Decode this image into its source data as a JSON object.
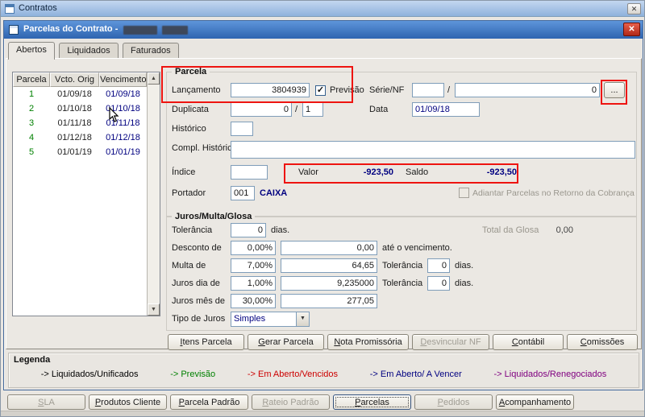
{
  "icons": {
    "close": "✕",
    "check": "✓",
    "dropdown_arrow": "▼",
    "scroll_up": "▲",
    "scroll_down": "▼"
  },
  "colors": {
    "previsao_green": "#008000",
    "vencidos_red": "#cc0000",
    "a_vencer_navy": "#000080",
    "renegociados_purple": "#800080",
    "annotation_red": "#ee1410"
  },
  "outer_window": {
    "title": "Contratos"
  },
  "inner_window": {
    "title": "Parcelas do Contrato -"
  },
  "tabs": {
    "abertos": "Abertos",
    "liquidados": "Liquidados",
    "faturados": "Faturados"
  },
  "grid": {
    "headers": {
      "parcela": "Parcela",
      "vcto_orig": "Vcto. Orig",
      "vencimento": "Vencimento"
    },
    "rows": [
      {
        "parcela": "1",
        "vcto_orig": "01/09/18",
        "vencimento": "01/09/18"
      },
      {
        "parcela": "2",
        "vcto_orig": "01/10/18",
        "vencimento": "01/10/18"
      },
      {
        "parcela": "3",
        "vcto_orig": "01/11/18",
        "vencimento": "01/11/18"
      },
      {
        "parcela": "4",
        "vcto_orig": "01/12/18",
        "vencimento": "01/12/18"
      },
      {
        "parcela": "5",
        "vcto_orig": "01/01/19",
        "vencimento": "01/01/19"
      }
    ]
  },
  "parcela": {
    "title": "Parcela",
    "lancamento": {
      "label": "Lançamento",
      "value": "3804939"
    },
    "previsao": {
      "label": "Previsão",
      "checked": true
    },
    "serie_nf": {
      "label": "Série/NF",
      "serie": "",
      "separator": "/",
      "numero": "0",
      "browse": "..."
    },
    "duplicata": {
      "label": "Duplicata",
      "numero": "0",
      "separator": "/",
      "ordem": "1"
    },
    "data": {
      "label": "Data",
      "value": "01/09/18"
    },
    "historico": {
      "label": "Histórico",
      "value": ""
    },
    "compl_historico": {
      "label": "Compl. Histórico",
      "value": ""
    },
    "indice": {
      "label": "Índice",
      "value": ""
    },
    "valor": {
      "label": "Valor",
      "value": "-923,50"
    },
    "saldo": {
      "label": "Saldo",
      "value": "-923,50"
    },
    "portador": {
      "label": "Portador",
      "code": "001",
      "name": "CAIXA"
    },
    "adiantar": {
      "label": "Adiantar Parcelas no Retorno da Cobrança",
      "checked": false
    }
  },
  "juros": {
    "title": "Juros/Multa/Glosa",
    "tolerancia": {
      "label": "Tolerância",
      "value": "0",
      "suffix": "dias."
    },
    "total_glosa": {
      "label": "Total da Glosa",
      "value": "0,00"
    },
    "desconto": {
      "label": "Desconto de",
      "percent": "0,00%",
      "value": "0,00",
      "suffix": "até o vencimento."
    },
    "multa": {
      "label": "Multa de",
      "percent": "7,00%",
      "value": "64,65",
      "tolerancia_label": "Tolerância",
      "tolerancia": "0",
      "suffix": "dias."
    },
    "juros_dia": {
      "label": "Juros dia de",
      "percent": "1,00%",
      "value": "9,235000",
      "tolerancia_label": "Tolerância",
      "tolerancia": "0",
      "suffix": "dias."
    },
    "juros_mes": {
      "label": "Juros mês de",
      "percent": "30,00%",
      "value": "277,05"
    },
    "tipo_juros": {
      "label": "Tipo de Juros",
      "value": "Simples"
    }
  },
  "action_buttons": {
    "itens_parcela": "Itens Parcela",
    "gerar_parcela": "Gerar Parcela",
    "nota_promissoria": "Nota Promissória",
    "desvincular_nf": "Desvincular NF",
    "contabil": "Contábil",
    "comissoes": "Comissões"
  },
  "legenda": {
    "title": "Legenda",
    "items": [
      {
        "text": "-> Liquidados/Unificados",
        "color": "#000000"
      },
      {
        "text": "-> Previsão",
        "color": "#008000"
      },
      {
        "text": "-> Em Aberto/Vencidos",
        "color": "#cc0000"
      },
      {
        "text": "-> Em Aberto/ A Vencer",
        "color": "#000080"
      },
      {
        "text": "-> Liquidados/Renegociados",
        "color": "#800080"
      }
    ]
  },
  "bottom_bar": {
    "sla": "SLA",
    "produtos_cliente": "Produtos Cliente",
    "parcela_padrao": "Parcela Padrão",
    "rateio_padrao": "Rateio Padrão",
    "parcelas": "Parcelas",
    "pedidos": "Pedidos",
    "acompanhamento": "Acompanhamento"
  }
}
